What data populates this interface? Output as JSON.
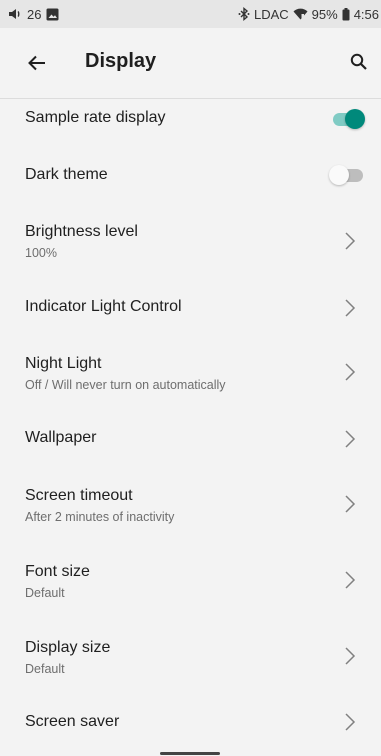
{
  "status_bar": {
    "volume_level": "26",
    "bluetooth_codec": "LDAC",
    "battery": "95%",
    "time": "4:56",
    "icons": [
      "volume-icon",
      "image-notification-icon",
      "bluetooth-icon",
      "wifi-icon",
      "battery-icon"
    ]
  },
  "app_bar": {
    "title": "Display",
    "back_icon": "arrow-left-icon",
    "search_icon": "search-icon"
  },
  "colors": {
    "accent": "#00897b",
    "accent_track": "#80cbc4",
    "toggle_off_track": "#bdbdbd",
    "toggle_off_knob": "#fafafa"
  },
  "settings": [
    {
      "title": "Sample rate display",
      "subtitle": "",
      "control": "toggle",
      "on": true
    },
    {
      "title": "Dark theme",
      "subtitle": "",
      "control": "toggle",
      "on": false
    },
    {
      "title": "Brightness level",
      "subtitle": "100%",
      "control": "chevron"
    },
    {
      "title": "Indicator Light Control",
      "subtitle": "",
      "control": "chevron"
    },
    {
      "title": "Night Light",
      "subtitle": "Off / Will never turn on automatically",
      "control": "chevron"
    },
    {
      "title": "Wallpaper",
      "subtitle": "",
      "control": "chevron"
    },
    {
      "title": "Screen timeout",
      "subtitle": "After 2 minutes of inactivity",
      "control": "chevron"
    },
    {
      "title": "Font size",
      "subtitle": "Default",
      "control": "chevron"
    },
    {
      "title": "Display size",
      "subtitle": "Default",
      "control": "chevron"
    },
    {
      "title": "Screen saver",
      "subtitle": "",
      "control": "chevron"
    }
  ]
}
